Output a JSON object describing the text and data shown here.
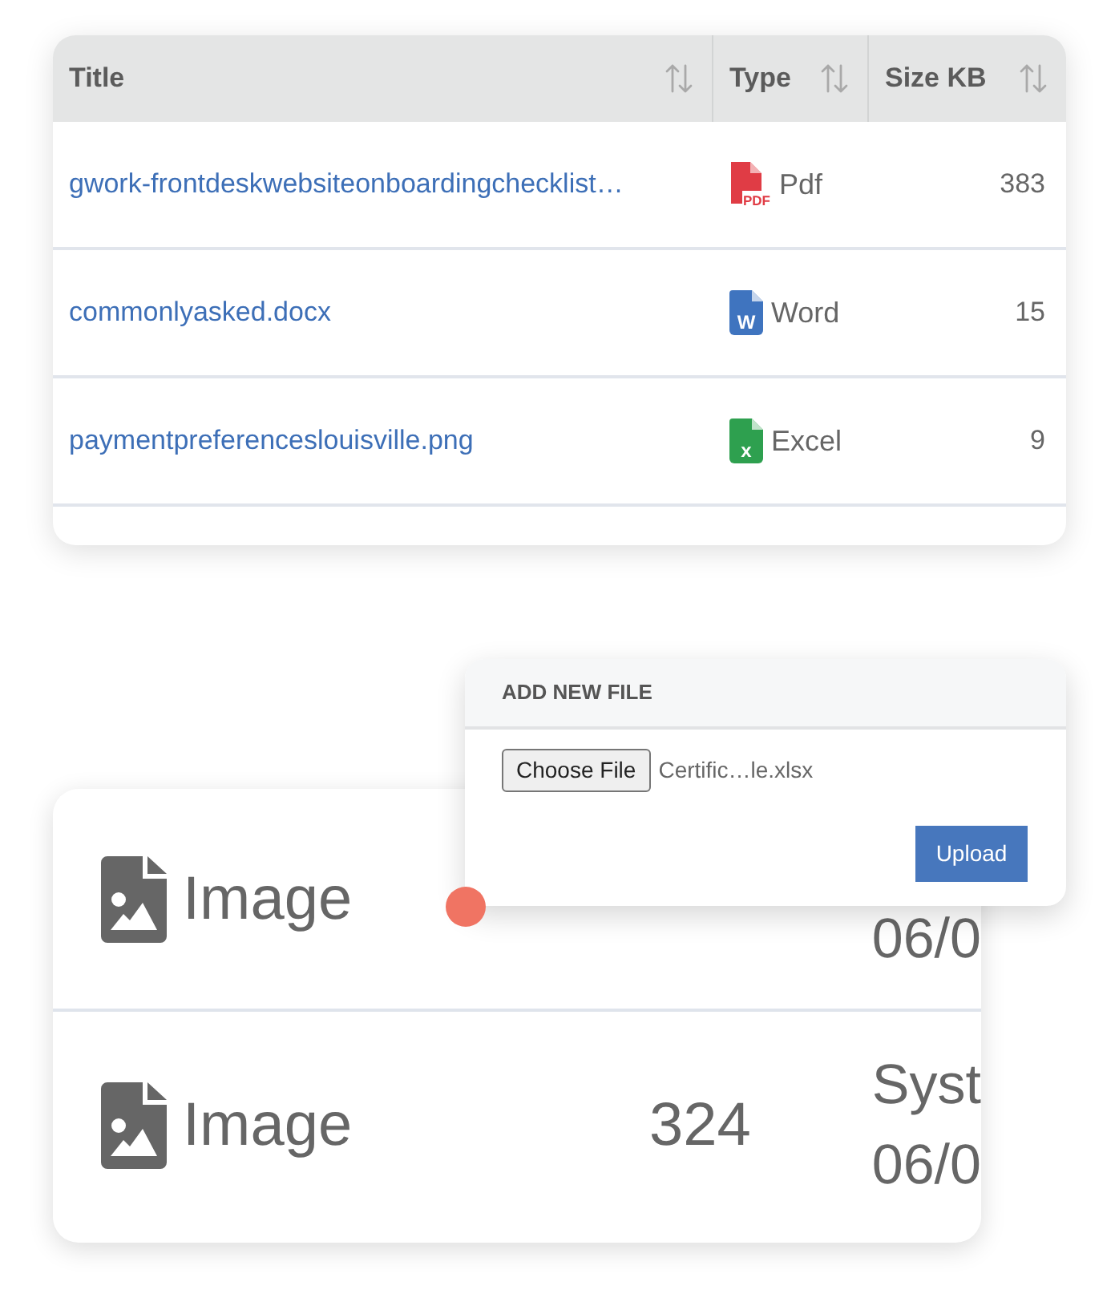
{
  "file_table": {
    "columns": [
      {
        "label": "Title"
      },
      {
        "label": "Type"
      },
      {
        "label": "Size KB"
      }
    ],
    "rows": [
      {
        "title": "gwork-frontdeskwebsiteonboardingchecklist…",
        "type": {
          "kind": "pdf",
          "icon_text": "PDF",
          "label": "Pdf"
        },
        "size": "383"
      },
      {
        "title": "commonlyasked.docx",
        "type": {
          "kind": "word",
          "icon_text": "W",
          "label": "Word"
        },
        "size": "15"
      },
      {
        "title": "paymentpreferenceslouisville.png",
        "type": {
          "kind": "excel",
          "icon_text": "x",
          "label": "Excel"
        },
        "size": "9"
      }
    ]
  },
  "file_list": {
    "rows": [
      {
        "type": "Image",
        "date_lines": [
          "06/0"
        ]
      },
      {
        "type": "Image",
        "size": "324",
        "date_lines": [
          "Syst",
          "06/0"
        ]
      }
    ]
  },
  "add_file_dialog": {
    "title": "ADD NEW FILE",
    "choose_button": "Choose File",
    "file_name": "Certific…le.xlsx",
    "upload_button": "Upload"
  }
}
